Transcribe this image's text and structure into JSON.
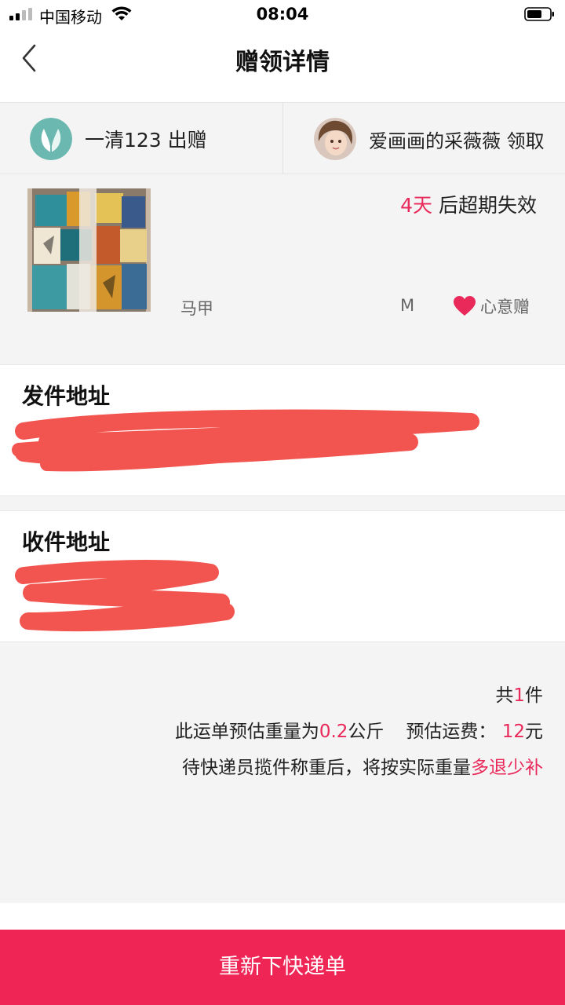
{
  "status_bar": {
    "carrier": "中国移动",
    "time": "08:04"
  },
  "nav": {
    "title": "赠领详情"
  },
  "parties": {
    "giver": {
      "name_text": "一清123 出赠",
      "avatar_icon": "leaf-logo-icon"
    },
    "receiver": {
      "name_text": "爱画画的采薇薇 领取",
      "avatar_icon": "girl-avatar"
    }
  },
  "product": {
    "expire_days": "4天",
    "expire_suffix": " 后超期失效",
    "name": "马甲",
    "size": "M",
    "gift_type": "心意赠"
  },
  "sender_address": {
    "heading": "发件地址"
  },
  "receiver_address": {
    "heading": "收件地址"
  },
  "summary": {
    "count_prefix": "共",
    "count": "1",
    "count_suffix": "件",
    "weight_prefix": "此运单预估重量为",
    "weight_value": "0.2",
    "weight_unit": "公斤",
    "fee_label": "预估运费：",
    "fee_value": "12",
    "fee_unit": "元",
    "note_prefix": "待快递员揽件称重后，将按实际重量",
    "note_highlight": "多退少补"
  },
  "actions": {
    "submit_label": "重新下快递单"
  },
  "colors": {
    "accent": "#e8295a",
    "button": "#ee2555",
    "background_gray": "#f4f4f4"
  }
}
